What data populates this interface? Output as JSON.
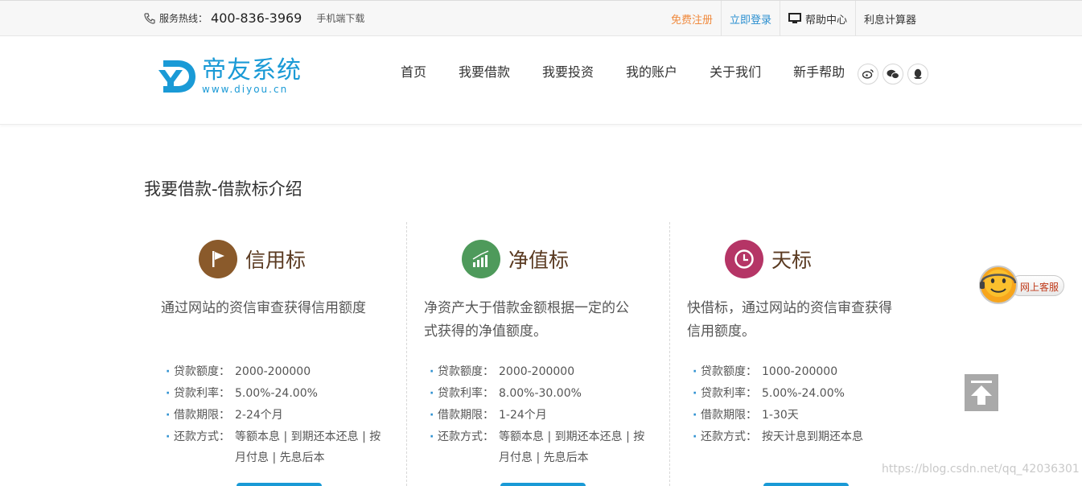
{
  "topbar": {
    "hotline_label": "服务热线：",
    "hotline_number": "400-836-3969",
    "app_download": "手机端下载",
    "links": {
      "register": "免费注册",
      "login": "立即登录",
      "help_center": "帮助中心",
      "calculator": "利息计算器"
    }
  },
  "logo": {
    "name": "帝友系统",
    "url": "www.diyou.cn"
  },
  "nav": [
    "首页",
    "我要借款",
    "我要投资",
    "我的账户",
    "关于我们",
    "新手帮助"
  ],
  "social": [
    "weibo-icon",
    "wechat-icon",
    "qq-icon"
  ],
  "page_title": "我要借款-借款标介绍",
  "loan_types": [
    {
      "name": "信用标",
      "icon": "flag-icon",
      "color": "#8a5a2b",
      "desc": [
        "通过网站的资信审查获得信用额度"
      ],
      "specs": [
        {
          "k": "贷款额度：",
          "v": "2000-200000"
        },
        {
          "k": "贷款利率：",
          "v": "5.00%-24.00%"
        },
        {
          "k": "借款期限：",
          "v": "2-24个月"
        },
        {
          "k": "还款方式：",
          "v1": "等额本息 | 到期还本还息 | 按",
          "v2": "月付息 | 先息后本"
        }
      ]
    },
    {
      "name": "净值标",
      "icon": "bar-chart-icon",
      "color": "#4e9a5b",
      "desc": [
        "净资产大于借款金额根据一定的公",
        "式获得的净值额度。"
      ],
      "specs": [
        {
          "k": "贷款额度：",
          "v": "2000-200000"
        },
        {
          "k": "贷款利率：",
          "v": "8.00%-30.00%"
        },
        {
          "k": "借款期限：",
          "v": "1-24个月"
        },
        {
          "k": "还款方式：",
          "v1": "等额本息 | 到期还本还息 | 按",
          "v2": "月付息 | 先息后本"
        }
      ]
    },
    {
      "name": "天标",
      "icon": "clock-icon",
      "color": "#b53566",
      "desc": [
        "快借标，通过网站的资信审查获得",
        "信用额度。"
      ],
      "specs": [
        {
          "k": "贷款额度：",
          "v": "1000-200000"
        },
        {
          "k": "贷款利率：",
          "v": "5.00%-24.00%"
        },
        {
          "k": "借款期限：",
          "v": "1-30天"
        },
        {
          "k": "还款方式：",
          "v": "按天计息到期还本息"
        }
      ]
    }
  ],
  "online_service": "网上客服",
  "watermark": "https://blog.csdn.net/qq_42036301"
}
